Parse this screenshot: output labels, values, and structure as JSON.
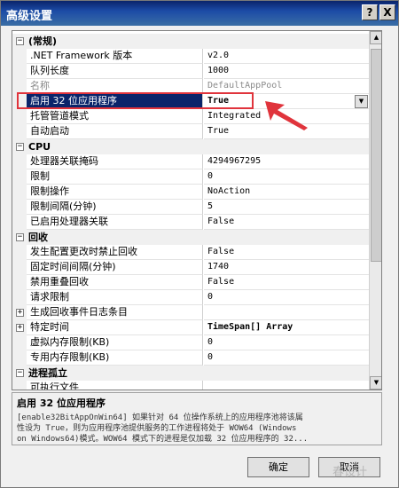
{
  "window": {
    "title": "高级设置",
    "help_label": "?",
    "close_label": "X"
  },
  "categories": {
    "general": {
      "toggle": "−",
      "label": "(常规)"
    },
    "cpu": {
      "toggle": "−",
      "label": "CPU"
    },
    "recycle": {
      "toggle": "−",
      "label": "回收"
    },
    "isolation": {
      "toggle": "−",
      "label": "进程孤立"
    }
  },
  "rows": {
    "g0": {
      "name": ".NET Framework 版本",
      "value": "v2.0"
    },
    "g1": {
      "name": "队列长度",
      "value": "1000"
    },
    "g2": {
      "name": "名称",
      "value": "DefaultAppPool"
    },
    "g3": {
      "name": "启用 32 位应用程序",
      "value": "True"
    },
    "g4": {
      "name": "托管管道模式",
      "value": "Integrated"
    },
    "g5": {
      "name": "自动启动",
      "value": "True"
    },
    "c0": {
      "name": "处理器关联掩码",
      "value": "4294967295"
    },
    "c1": {
      "name": "限制",
      "value": "0"
    },
    "c2": {
      "name": "限制操作",
      "value": "NoAction"
    },
    "c3": {
      "name": "限制间隔(分钟)",
      "value": "5"
    },
    "c4": {
      "name": "已启用处理器关联",
      "value": "False"
    },
    "r0": {
      "name": "发生配置更改时禁止回收",
      "value": "False"
    },
    "r1": {
      "name": "固定时间间隔(分钟)",
      "value": "1740"
    },
    "r2": {
      "name": "禁用重叠回收",
      "value": "False"
    },
    "r3": {
      "name": "请求限制",
      "value": "0"
    },
    "r4": {
      "name": "生成回收事件日志条目",
      "value": "",
      "toggle": "+"
    },
    "r5": {
      "name": "特定时间",
      "value": "TimeSpan[] Array",
      "toggle": "+"
    },
    "r6": {
      "name": "虚拟内存限制(KB)",
      "value": "0"
    },
    "r7": {
      "name": "专用内存限制(KB)",
      "value": "0"
    },
    "i0": {
      "name": "可执行文件",
      "value": ""
    }
  },
  "description": {
    "title": "启用 32 位应用程序",
    "line1": "[enable32BitAppOnWin64] 如果针对 64 位操作系统上的应用程序池将该属",
    "line2": "性设为 True，则为应用程序池提供服务的工作进程将处于 WOW64 (Windows",
    "line3": "on Windows64)模式。WOW64 模式下的进程是仅加载 32 位应用程序的 32..."
  },
  "buttons": {
    "ok": "确定",
    "cancel": "取消"
  },
  "watermark": "春设计",
  "colors": {
    "accent": "#0a246a",
    "highlight": "#e0343c"
  }
}
